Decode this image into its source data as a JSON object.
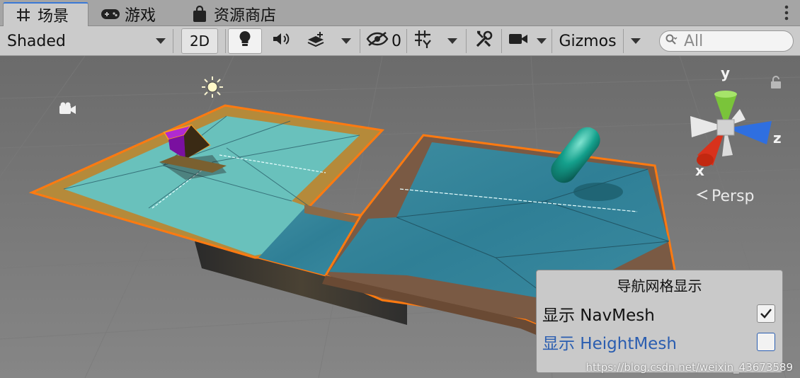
{
  "tabs": [
    {
      "label": "场景",
      "icon": "grid-icon",
      "active": true
    },
    {
      "label": "游戏",
      "icon": "gamepad-icon",
      "active": false
    },
    {
      "label": "资源商店",
      "icon": "shopping-bag-icon",
      "active": false
    }
  ],
  "toolbar": {
    "draw_mode": "Shaded",
    "mode_2d": "2D",
    "hidden_count": "0",
    "gizmos_label": "Gizmos",
    "search_placeholder": "All"
  },
  "viewport": {
    "projection_label": "Persp",
    "axes": {
      "x": "x",
      "y": "y",
      "z": "z"
    }
  },
  "navmesh_overlay": {
    "title": "导航网格显示",
    "options": [
      {
        "label": "显示 NavMesh",
        "checked": true,
        "selected": false
      },
      {
        "label": "显示 HeightMesh",
        "checked": false,
        "selected": true
      }
    ]
  },
  "watermark": "https://blog.csdn.net/weixin_43673589",
  "colors": {
    "accent": "#3a79d6",
    "selection_outline": "#ff7a10",
    "navmesh": "#5ec3c9",
    "axis_x": "#d8321c",
    "axis_y": "#7ac43a",
    "axis_z": "#2f6fe0"
  }
}
